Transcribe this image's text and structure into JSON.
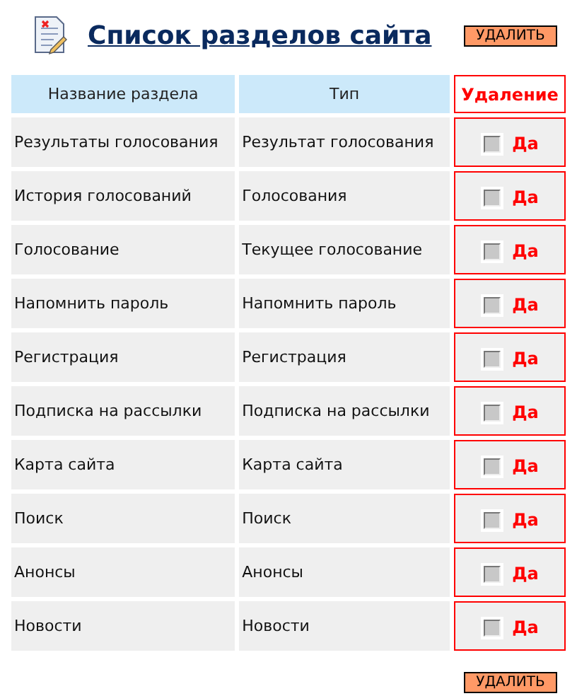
{
  "title": "Список разделов сайта",
  "delete_button_top": "УДАЛИТЬ",
  "table": {
    "columns": [
      "Название раздела",
      "Тип",
      "Удаление"
    ],
    "rows": [
      {
        "name": "Результаты голосования",
        "type": "Результат голосования",
        "checked": false,
        "label": "Да"
      },
      {
        "name": "История голосований",
        "type": "Голосования",
        "checked": false,
        "label": "Да"
      },
      {
        "name": "Голосование",
        "type": "Текущее голосование",
        "checked": false,
        "label": "Да"
      },
      {
        "name": "Напомнить пароль",
        "type": "Напомнить пароль",
        "checked": false,
        "label": "Да"
      },
      {
        "name": "Регистрация",
        "type": "Регистрация",
        "checked": false,
        "label": "Да"
      },
      {
        "name": "Подписка на рассылки",
        "type": "Подписка на рассылки",
        "checked": false,
        "label": "Да"
      },
      {
        "name": "Карта сайта",
        "type": "Карта сайта",
        "checked": false,
        "label": "Да"
      },
      {
        "name": "Поиск",
        "type": "Поиск",
        "checked": false,
        "label": "Да"
      },
      {
        "name": "Анонсы",
        "type": "Анонсы",
        "checked": false,
        "label": "Да"
      },
      {
        "name": "Новости",
        "type": "Новости",
        "checked": false,
        "label": "Да"
      }
    ]
  },
  "delete_button_bottom": "УДАЛИТЬ"
}
